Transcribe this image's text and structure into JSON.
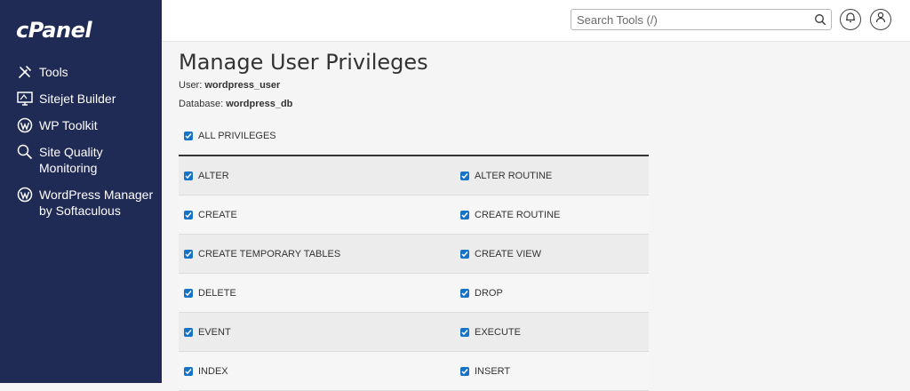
{
  "brand": {
    "logo": "cPanel"
  },
  "sidebar": {
    "items": [
      {
        "label": "Tools",
        "icon": "tools-icon"
      },
      {
        "label": "Sitejet Builder",
        "icon": "monitor-icon"
      },
      {
        "label": "WP Toolkit",
        "icon": "wordpress-icon"
      },
      {
        "label": "Site Quality Monitoring",
        "icon": "magnifier-icon"
      },
      {
        "label": "WordPress Manager by Softaculous",
        "icon": "wordpress-icon"
      }
    ]
  },
  "header": {
    "search_placeholder": "Search Tools (/)"
  },
  "page": {
    "title": "Manage User Privileges",
    "user_label": "User:",
    "user_value": "wordpress_user",
    "database_label": "Database:",
    "database_value": "wordpress_db",
    "all_privileges": "ALL PRIVILEGES"
  },
  "privileges": [
    [
      "ALTER",
      "ALTER ROUTINE"
    ],
    [
      "CREATE",
      "CREATE ROUTINE"
    ],
    [
      "CREATE TEMPORARY TABLES",
      "CREATE VIEW"
    ],
    [
      "DELETE",
      "DROP"
    ],
    [
      "EVENT",
      "EXECUTE"
    ],
    [
      "INDEX",
      "INSERT"
    ]
  ],
  "colors": {
    "sidebar": "#1f2a55",
    "checkbox": "#1673c5"
  }
}
